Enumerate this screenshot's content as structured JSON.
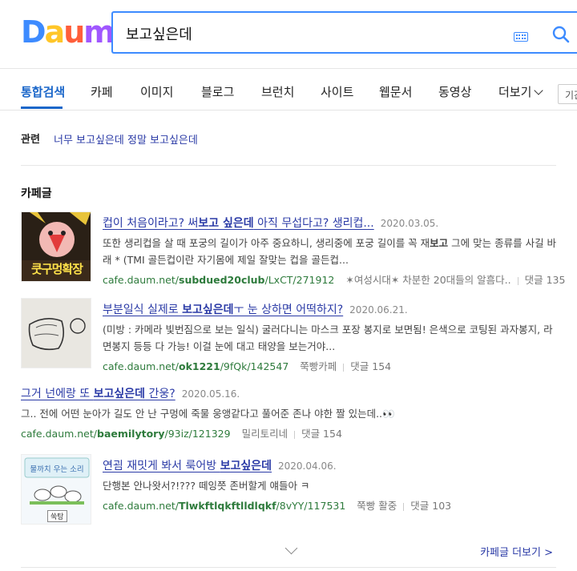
{
  "logo": {
    "letters": [
      "D",
      "a",
      "u",
      "m"
    ],
    "colors": [
      "#3d8bff",
      "#ffc629",
      "#ff5e3a",
      "#a057ff"
    ]
  },
  "search": {
    "query": "보고싶은데"
  },
  "tabs": [
    {
      "label": "통합검색",
      "active": true
    },
    {
      "label": "카페"
    },
    {
      "label": "이미지"
    },
    {
      "label": "블로그"
    },
    {
      "label": "브런치"
    },
    {
      "label": "사이트"
    },
    {
      "label": "웹문서"
    },
    {
      "label": "동영상"
    },
    {
      "label": "더보기"
    }
  ],
  "period_select": "기간",
  "related": {
    "label": "관련",
    "links": [
      "너무 보고싶은데",
      "정말 보고싶은데"
    ]
  },
  "section": {
    "title": "카페글",
    "more_label": "카페글 더보기 >"
  },
  "results": [
    {
      "thumb_text": "쿳구멍확장",
      "title_parts": [
        "컵이 처음이라고? 써",
        "보고 싶은데",
        " 아직 무섭다고? 생리컵..."
      ],
      "date": "2020.03.05.",
      "desc_parts": [
        "또한 생리컵을 살 때 포궁의 길이가 아주 중요하니, 생리중에 포궁 길이를 꼭 재",
        "보고",
        " 그에 맞는 종류를 사길 바래 * (TMI 골든컵이란 자기몸에 제일 잘맞는 컵을 골든컵..."
      ],
      "url_prefix": "cafe.daum.net/",
      "url_bold": "subdued20club",
      "url_rest": "/LxCT/271912",
      "cafe": "✶여성시대✶ 차분한 20대들의 알흠다..",
      "comments": "댓글 135"
    },
    {
      "title_parts": [
        "부분일식 실제로 ",
        "보고싶은데",
        "ㅜ 눈 상하면 어떡하지?"
      ],
      "date": "2020.06.21.",
      "desc_parts": [
        "(미방 : 카메라 빛번짐으로 보는 일식) 굴러다니는 마스크 포장 봉지로 보면됨! 은색으로 코팅된 과자봉지, 라면봉지 등등 다 가능! 이걸 눈에 대고 태양을 보는거야..."
      ],
      "url_prefix": "cafe.daum.net/",
      "url_bold": "ok1221",
      "url_rest": "/9fQk/142547",
      "cafe": "쭉빵카페",
      "comments": "댓글 154"
    },
    {
      "title_parts": [
        "그거 넌에랑 또 ",
        "보고싶은데",
        " 간웅?"
      ],
      "date": "2020.05.16.",
      "desc_parts": [
        "그.. 전에 어떤 눈아가 길도 안 난 구멍에 죽물 웅앵같다고 풀어준 존나 야한 짤 있는데..👀"
      ],
      "url_prefix": "cafe.daum.net/",
      "url_bold": "baemilytory",
      "url_rest": "/93iz/121329",
      "cafe": "밀리토리네",
      "comments": "댓글 154"
    },
    {
      "thumb_text": "물까치 우는 소리",
      "thumb_tag": "쑥탕",
      "title_parts": [
        "연굄 재밋게 봐서 룩어방 ",
        "보고싶은데",
        ""
      ],
      "date": "2020.04.06.",
      "desc_parts": [
        "단행본 안나왓서?!??? 떼잉쯧 존버할게 얘들아 ㅋ"
      ],
      "url_prefix": "cafe.daum.net/",
      "url_bold": "Tlwkftlqkftlldlqkf",
      "url_rest": "/8vYY/117531",
      "cafe": "쭉빵 활중",
      "comments": "댓글 103"
    }
  ]
}
